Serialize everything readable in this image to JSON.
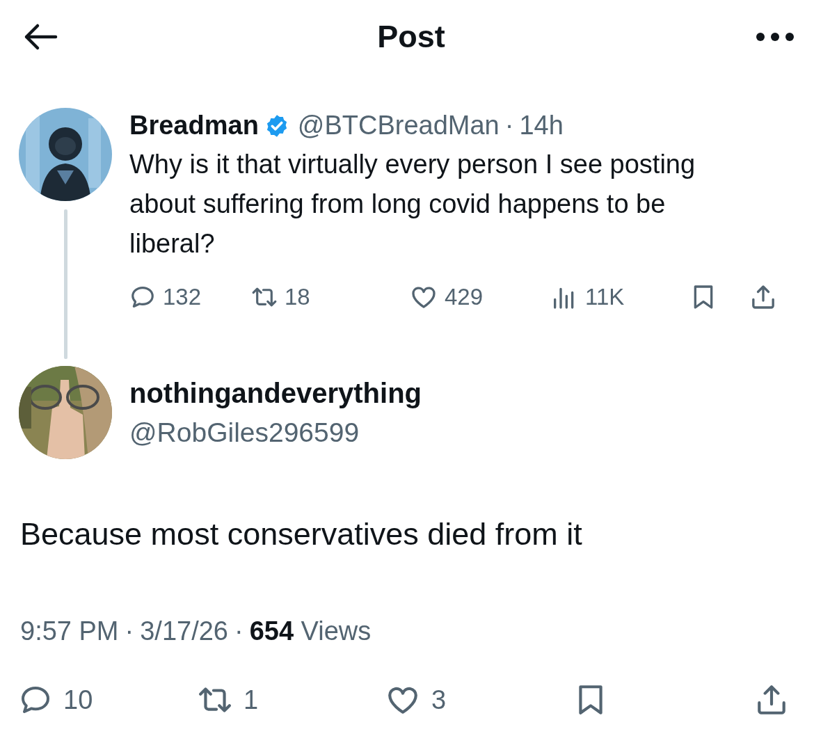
{
  "header": {
    "title": "Post"
  },
  "parent_post": {
    "name": "Breadman",
    "verified": true,
    "handle": "@BTCBreadMan",
    "separator": "·",
    "time": "14h",
    "text": "Why is it that virtually every person I see posting about suffering from long covid happens to be liberal?",
    "stats": {
      "replies": "132",
      "reposts": "18",
      "likes": "429",
      "views": "11K"
    }
  },
  "reply": {
    "name": "nothingandeverything",
    "handle": "@RobGiles296599",
    "text": "Because most conservatives died from it",
    "time": "9:57 PM",
    "separator_1": "·",
    "date": "3/17/26",
    "separator_2": "·",
    "views_count": "654",
    "views_label": "Views",
    "stats": {
      "replies": "10",
      "reposts": "1",
      "likes": "3"
    }
  }
}
